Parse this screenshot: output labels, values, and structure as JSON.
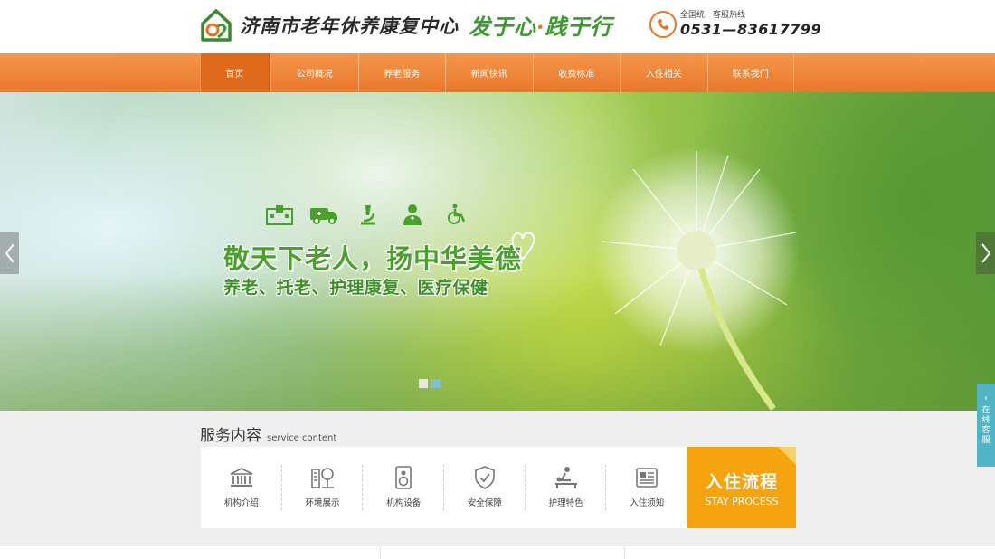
{
  "header": {
    "logo_text": "济南市老年休养康复中心",
    "slogan_part1": "发于心",
    "slogan_dot": "·",
    "slogan_part2": "践于行",
    "hotline_label": "全国统一客服热线",
    "hotline_number": "0531—83617799"
  },
  "nav": {
    "items": [
      "首页",
      "公司概况",
      "养老服务",
      "新闻快讯",
      "收费标准",
      "入住相关",
      "联系我们"
    ],
    "active_index": 0
  },
  "banner": {
    "icons": [
      "hospital-icon",
      "ambulance-icon",
      "microscope-icon",
      "doctor-icon",
      "wheelchair-icon"
    ],
    "headline": "敬天下老人，扬中华美德",
    "subline": "养老、托老、护理康复、医疗保健",
    "slide_count": 2,
    "active_slide": 1
  },
  "service": {
    "title_cn": "服务内容",
    "title_en": "service content",
    "items": [
      {
        "label": "机构介绍",
        "icon": "building-icon"
      },
      {
        "label": "环境展示",
        "icon": "environment-icon"
      },
      {
        "label": "机构设备",
        "icon": "device-icon"
      },
      {
        "label": "安全保障",
        "icon": "shield-icon"
      },
      {
        "label": "护理特色",
        "icon": "care-icon"
      },
      {
        "label": "入住须知",
        "icon": "notice-icon"
      }
    ],
    "stay_cn": "入住流程",
    "stay_en": "STAY PROCESS"
  },
  "float_tab": {
    "text": "在线客服"
  },
  "colors": {
    "accent_orange": "#ef8534",
    "brand_green": "#4aa02c",
    "stay_orange": "#f5a30f",
    "float_teal": "#52b5c5"
  }
}
